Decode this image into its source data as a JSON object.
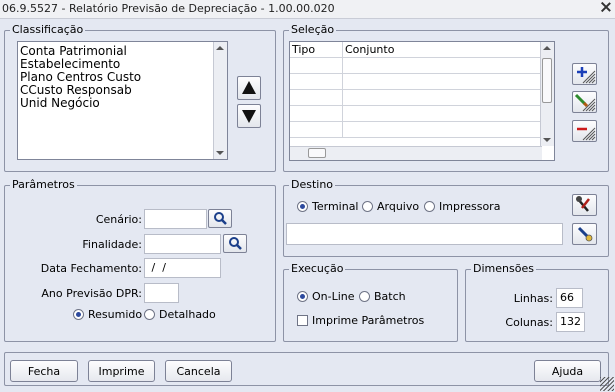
{
  "window": {
    "title": "06.9.5527 - Relatório Previsão de Depreciação - 1.00.00.020"
  },
  "classificacao": {
    "legend": "Classificação",
    "items": [
      "Conta Patrimonial",
      "Estabelecimento",
      "Plano Centros Custo",
      "CCusto Responsab",
      "Unid Negócio"
    ]
  },
  "selecao": {
    "legend": "Seleção",
    "columns": [
      "Tipo",
      "Conjunto"
    ],
    "rows": 6
  },
  "parametros": {
    "legend": "Parâmetros",
    "cenario_label": "Cenário:",
    "cenario_value": "",
    "finalidade_label": "Finalidade:",
    "finalidade_value": "",
    "data_label": "Data Fechamento:",
    "data_value": " /  /",
    "ano_label": "Ano Previsão DPR:",
    "ano_value": "",
    "resumido": "Resumido",
    "detalhado": "Detalhado",
    "selected": "Resumido"
  },
  "destino": {
    "legend": "Destino",
    "terminal": "Terminal",
    "arquivo": "Arquivo",
    "impressora": "Impressora",
    "selected": "Terminal",
    "path_value": ""
  },
  "execucao": {
    "legend": "Execução",
    "online": "On-Line",
    "batch": "Batch",
    "selected": "On-Line",
    "imprime_label": "Imprime Parâmetros",
    "imprime_checked": false
  },
  "dimensoes": {
    "legend": "Dimensões",
    "linhas_label": "Linhas:",
    "linhas_value": "66",
    "colunas_label": "Colunas:",
    "colunas_value": "132"
  },
  "footer": {
    "fecha": "Fecha",
    "imprime": "Imprime",
    "cancela": "Cancela",
    "ajuda": "Ajuda"
  }
}
